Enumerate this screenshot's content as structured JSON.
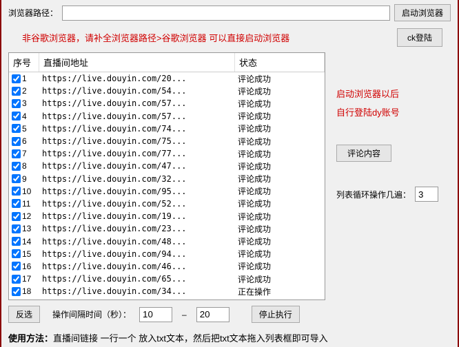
{
  "top": {
    "path_label": "浏览器路径：",
    "path_value": "",
    "launch_btn": "启动浏览器"
  },
  "warning": "非谷歌浏览器，请补全浏览器路径>谷歌浏览器 可以直接启动浏览器",
  "ck_login_btn": "ck登陆",
  "table": {
    "headers": {
      "seq": "序号",
      "url": "直播间地址",
      "status": "状态"
    },
    "rows": [
      {
        "n": "1",
        "url": "https://live.douyin.com/20...",
        "status": "评论成功"
      },
      {
        "n": "2",
        "url": "https://live.douyin.com/54...",
        "status": "评论成功"
      },
      {
        "n": "3",
        "url": "https://live.douyin.com/57...",
        "status": "评论成功"
      },
      {
        "n": "4",
        "url": "https://live.douyin.com/57...",
        "status": "评论成功"
      },
      {
        "n": "5",
        "url": "https://live.douyin.com/74...",
        "status": "评论成功"
      },
      {
        "n": "6",
        "url": "https://live.douyin.com/75...",
        "status": "评论成功"
      },
      {
        "n": "7",
        "url": "https://live.douyin.com/77...",
        "status": "评论成功"
      },
      {
        "n": "8",
        "url": "https://live.douyin.com/47...",
        "status": "评论成功"
      },
      {
        "n": "9",
        "url": "https://live.douyin.com/32...",
        "status": "评论成功"
      },
      {
        "n": "10",
        "url": "https://live.douyin.com/95...",
        "status": "评论成功"
      },
      {
        "n": "11",
        "url": "https://live.douyin.com/52...",
        "status": "评论成功"
      },
      {
        "n": "12",
        "url": "https://live.douyin.com/19...",
        "status": "评论成功"
      },
      {
        "n": "13",
        "url": "https://live.douyin.com/23...",
        "status": "评论成功"
      },
      {
        "n": "14",
        "url": "https://live.douyin.com/48...",
        "status": "评论成功"
      },
      {
        "n": "15",
        "url": "https://live.douyin.com/94...",
        "status": "评论成功"
      },
      {
        "n": "16",
        "url": "https://live.douyin.com/46...",
        "status": "评论成功"
      },
      {
        "n": "17",
        "url": "https://live.douyin.com/65...",
        "status": "评论成功"
      },
      {
        "n": "18",
        "url": "https://live.douyin.com/34...",
        "status": "正在操作"
      }
    ]
  },
  "side": {
    "hint1": "启动浏览器以后",
    "hint2": "自行登陆dy账号",
    "comment_btn": "评论内容",
    "loop_label": "列表循环操作几遍：",
    "loop_value": "3"
  },
  "bottom": {
    "invert_btn": "反选",
    "interval_label": "操作间隔时间（秒）：",
    "interval_min": "10",
    "interval_max": "20",
    "stop_btn": "停止执行"
  },
  "usage": {
    "label": "使用方法：",
    "text": "直播间链接 一行一个 放入txt文本，然后把txt文本拖入列表框即可导入"
  }
}
